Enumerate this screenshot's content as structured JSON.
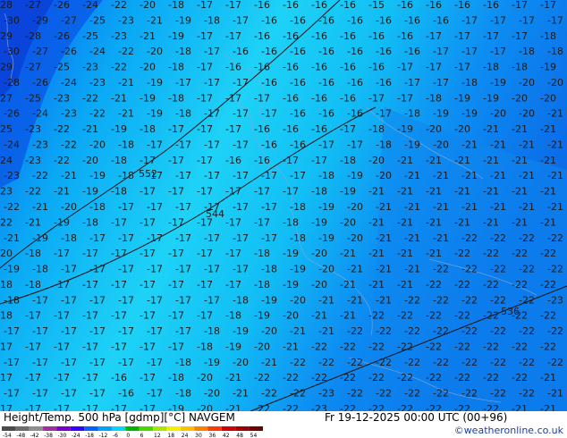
{
  "footer": {
    "title": "Height/Temp. 500 hPa [gdmp][°C] NAVGEM",
    "valid": "Fr 19-12-2025 00:00 UTC (00+96)",
    "credit": "©weatheronline.co.uk"
  },
  "legend": {
    "ticks": [
      "-54",
      "-48",
      "-42",
      "-38",
      "-30",
      "-24",
      "-18",
      "-12",
      "-6",
      "0",
      "6",
      "12",
      "18",
      "24",
      "30",
      "36",
      "42",
      "48",
      "54"
    ],
    "colors": [
      "#4b4b4b",
      "#6c6c6c",
      "#8f8f8f",
      "#a0309c",
      "#7a00c8",
      "#3a00ff",
      "#0063ff",
      "#00a2ff",
      "#00d8ff",
      "#00b400",
      "#4cd600",
      "#a8e800",
      "#f0f000",
      "#ffc000",
      "#ff8000",
      "#ff3c00",
      "#d20000",
      "#a00000",
      "#700000"
    ]
  },
  "map": {
    "contours": [
      "552",
      "544",
      "536"
    ],
    "rows": [
      "-28 -27 -26 -24 -22 -20 -18 -17 -17 -16 -16 -16 -16 -15 -16 -16 -16 -16 -17 -17",
      "-30 -29 -27 -25 -23 -21 -19 -18 -17 -16 -16 -16 -16 -16 -16 -16 -17 -17 -17 -17",
      "-29 -28 -26 -25 -23 -21 -19 -17 -17 -16 -16 -16 -16 -16 -16 -17 -17 -17 -17 -18",
      "-30 -27 -26 -24 -22 -20 -18 -17 -16 -16 -16 -16 -16 -16 -16 -17 -17 -17 -18 -18",
      "-29 -27 -25 -23 -22 -20 -18 -17 -16 -16 -16 -16 -16 -16 -17 -17 -17 -18 -18 -19",
      "-28 -26 -24 -23 -21 -19 -17 -17 -17 -16 -16 -16 -16 -16 -17 -17 -18 -19 -20 -20",
      "-27 -25 -23 -22 -21 -19 -18 -17 -17 -17 -16 -16 -16 -17 -17 -18 -19 -19 -20 -20",
      "-26 -24 -23 -22 -21 -19 -18 -17 -17 -17 -16 -16 -16 -17 -18 -19 -19 -20 -20 -21",
      "-25 -23 -22 -21 -19 -18 -17 -17 -17 -16 -16 -16 -17 -18 -19 -20 -20 -21 -21 -21",
      "-24 -23 -22 -20 -18 -17 -17 -17 -17 -16 -16 -17 -17 -18 -19 -20 -21 -21 -21 -21",
      "-24 -23 -22 -20 -18 -17 -17 -17 -16 -16 -17 -17 -18 -20 -21 -21 -21 -21 -21 -21",
      "-23 -22 -21 -19 -18 -17 -17 -17 -17 -17 -17 -18 -19 -20 -21 -21 -21 -21 -21 -21",
      "-23 -22 -21 -19 -18 -17 -17 -17 -17 -17 -17 -18 -19 -21 -21 -21 -21 -21 -21 -21",
      "-22 -21 -20 -18 -17 -17 -17 -17 -17 -17 -18 -19 -20 -21 -21 -21 -21 -21 -21 -21",
      "-22 -21 -19 -18 -17 -17 -17 -17 -17 -17 -18 -19 -20 -21 -21 -21 -21 -21 -21 -21",
      "-21 -19 -18 -17 -17 -17 -17 -17 -17 -17 -18 -19 -20 -21 -21 -21 -22 -22 -22 -22",
      "-20 -18 -17 -17 -17 -17 -17 -17 -17 -18 -19 -20 -21 -21 -21 -21 -22 -22 -22 -22",
      "-19 -18 -17 -17 -17 -17 -17 -17 -17 -18 -19 -20 -21 -21 -21 -22 -22 -22 -22 -22",
      "-18 -18 -17 -17 -17 -17 -17 -17 -17 -18 -19 -20 -21 -21 -21 -22 -22 -22 -22 -22",
      "-18 -17 -17 -17 -17 -17 -17 -17 -18 -19 -20 -21 -21 -21 -22 -22 -22 -22 -22 -23",
      "-18 -17 -17 -17 -17 -17 -17 -17 -18 -19 -20 -21 -21 -22 -22 -22 -22 -22 -22 -22",
      "-17 -17 -17 -17 -17 -17 -17 -18 -19 -20 -21 -21 -22 -22 -22 -22 -22 -22 -22 -22",
      "-17 -17 -17 -17 -17 -17 -17 -18 -19 -20 -21 -22 -22 -22 -22 -22 -22 -22 -22 -22",
      "-17 -17 -17 -17 -17 -17 -18 -19 -20 -21 -22 -22 -22 -22 -22 -22 -22 -22 -22 -22",
      "-17 -17 -17 -17 -16 -17 -18 -20 -21 -22 -22 -22 -22 -22 -22 -22 -22 -22 -22 -21",
      "-17 -17 -17 -17 -16 -17 -18 -20 -21 -22 -22 -23 -22 -22 -22 -22 -22 -22 -22 -21",
      "-17 -17 -17 -17 -17 -17 -19 -20 -21 -22 -22 -23 -22 -22 -22 -22 -22 -22 -21 -21"
    ]
  }
}
